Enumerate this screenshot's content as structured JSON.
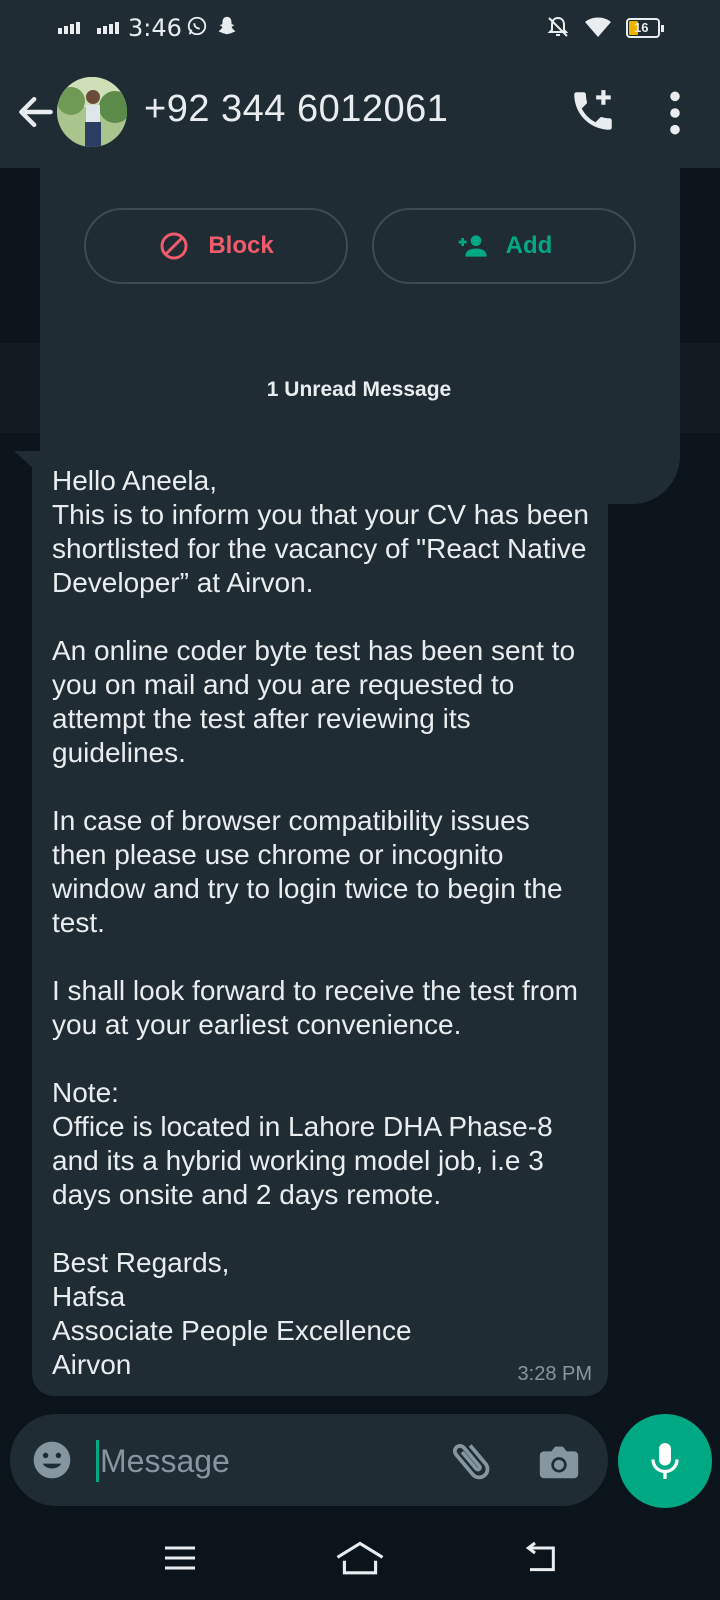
{
  "status_bar": {
    "time": "3:46",
    "battery": "16",
    "icons": [
      "signal-icon",
      "signal-icon",
      "whatsapp-icon",
      "snapchat-icon",
      "notifications-off-icon",
      "wifi-icon",
      "battery-icon"
    ]
  },
  "header": {
    "contact_name": "+92 344 6012061",
    "icons": [
      "back-arrow-icon",
      "avatar",
      "add-call-icon",
      "more-vert-icon"
    ]
  },
  "contact_card": {
    "block_label": "Block",
    "add_label": "Add"
  },
  "unread_label": "1 Unread Message",
  "message": {
    "text": "Hello Aneela,\nThis is to inform you that your CV has been shortlisted for the vacancy of \"React Native Developer” at Airvon.\n\nAn online coder byte test has been sent to you on mail and you are requested to attempt the test after reviewing its guidelines.\n\nIn case of browser compatibility issues then please use chrome or incognito window and try to login twice to begin the test.\n\nI shall look forward to receive the test from you at your earliest convenience.\n\nNote:\nOffice is located in Lahore DHA Phase-8 and its a hybrid working model job, i.e 3 days onsite and 2 days remote.\n\nBest Regards,\nHafsa\nAssociate People Excellence\nAirvon",
    "time": "3:28 PM"
  },
  "composer": {
    "placeholder": "Message"
  },
  "colors": {
    "accent": "#00a884",
    "block_red": "#f15c6d",
    "bubble": "#202c33",
    "bar": "#1f2c34",
    "background": "#0b141a"
  }
}
